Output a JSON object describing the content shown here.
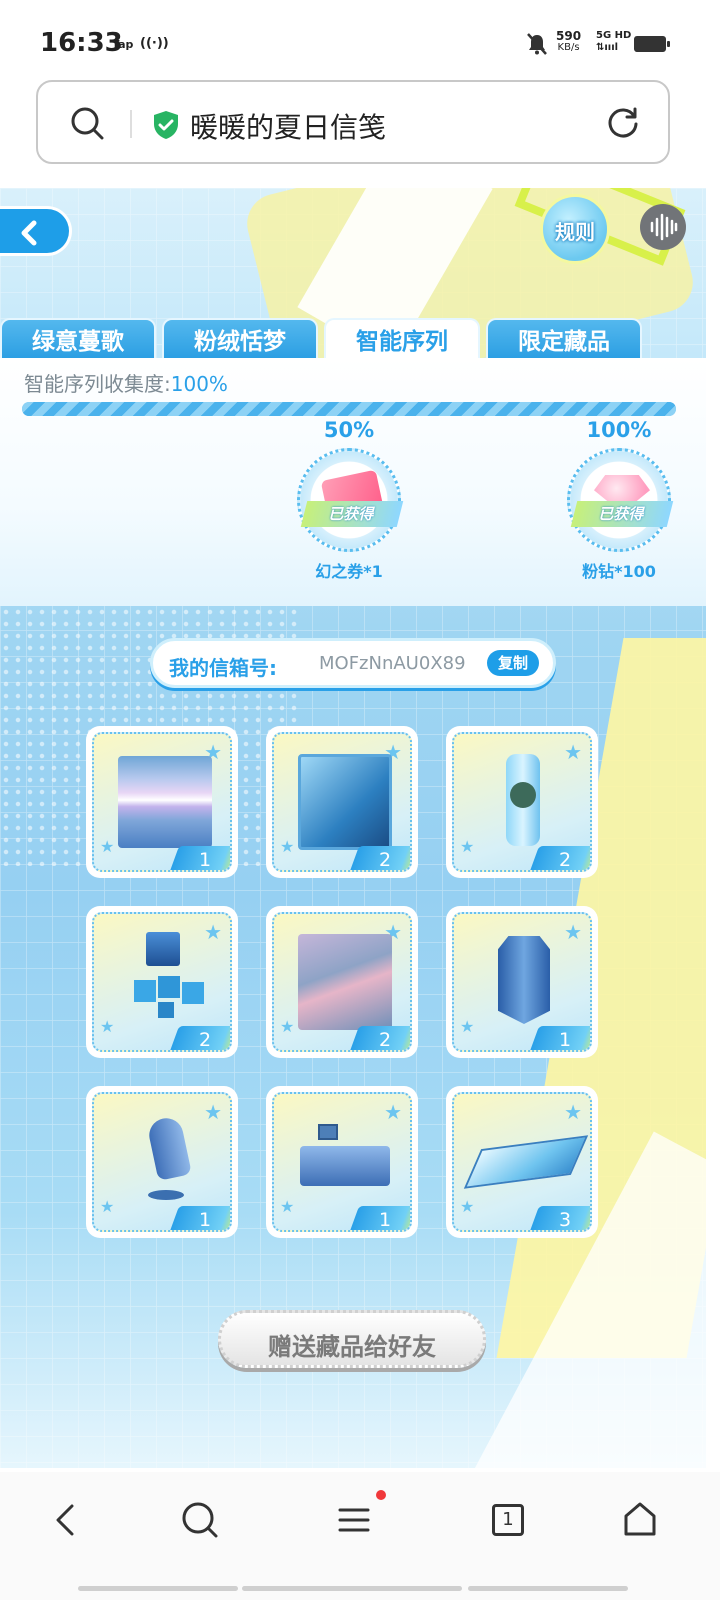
{
  "status_bar": {
    "time": "16:33",
    "tap_label": "Tap",
    "radio_label": "((·))",
    "speed_value": "590",
    "speed_unit": "KB/s",
    "network_top": "5G HD",
    "network_bottom": "⇅ıııl"
  },
  "url_bar": {
    "title": "暖暖的夏日信笺",
    "icons": [
      "search-icon",
      "shield-check-icon",
      "reload-icon"
    ]
  },
  "game": {
    "rule_label": "规则",
    "tabs": [
      {
        "label": "绿意蔓歌",
        "active": false
      },
      {
        "label": "粉绒恬梦",
        "active": false
      },
      {
        "label": "智能序列",
        "active": true
      },
      {
        "label": "限定藏品",
        "active": false
      }
    ],
    "collection": {
      "label": "智能序列收集度:",
      "value": "100%",
      "progress_fraction": 1.0
    },
    "milestones": [
      {
        "pct": "50%",
        "status": "已获得",
        "reward": "幻之券*1"
      },
      {
        "pct": "100%",
        "status": "已获得",
        "reward": "粉钻*100"
      }
    ],
    "mailbox": {
      "label": "我的信箱号:",
      "id": "MOFzNnAU0X89",
      "copy_label": "复制"
    },
    "items": [
      {
        "name": "striped-wallpaper",
        "count": "1"
      },
      {
        "name": "tech-door",
        "count": "2"
      },
      {
        "name": "plant-capsule",
        "count": "2"
      },
      {
        "name": "cube-set",
        "count": "2"
      },
      {
        "name": "character-poster",
        "count": "2"
      },
      {
        "name": "shield-cabinet",
        "count": "1"
      },
      {
        "name": "egg-chair",
        "count": "1"
      },
      {
        "name": "computer-desk",
        "count": "1"
      },
      {
        "name": "glass-floor-panel",
        "count": "3"
      }
    ],
    "gift_button": "赠送藏品给好友"
  },
  "nav_bar": {
    "items": [
      "back-icon",
      "search-icon",
      "menu-icon",
      "tabs-icon",
      "home-icon"
    ],
    "tab_count": "1"
  },
  "colors": {
    "accent": "#2aa0e8",
    "notification": "#f0383a"
  }
}
